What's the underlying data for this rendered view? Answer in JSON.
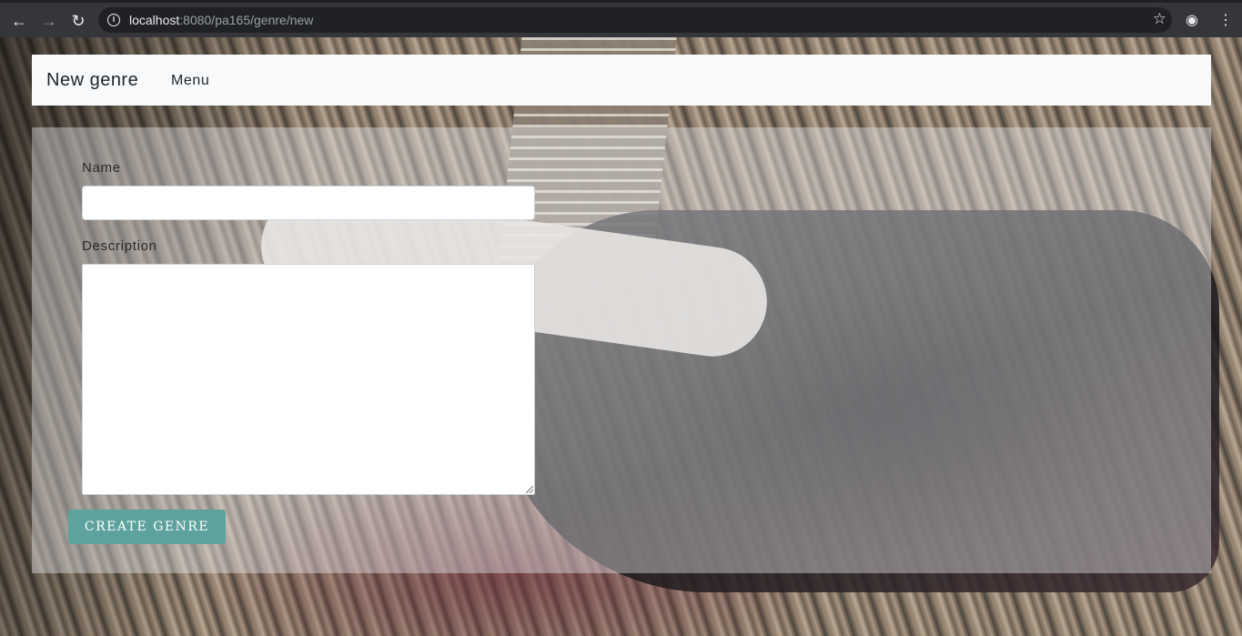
{
  "browser": {
    "url_host": "localhost",
    "url_rest": ":8080/pa165/genre/new"
  },
  "navbar": {
    "brand": "New genre",
    "menu": "Menu"
  },
  "form": {
    "name_label": "Name",
    "name_value": "",
    "description_label": "Description",
    "description_value": "",
    "submit_label": "CREATE GENRE"
  },
  "colors": {
    "button": "#5ea29d",
    "navbar": "#f8f9fa",
    "chrome": "#35363a"
  }
}
